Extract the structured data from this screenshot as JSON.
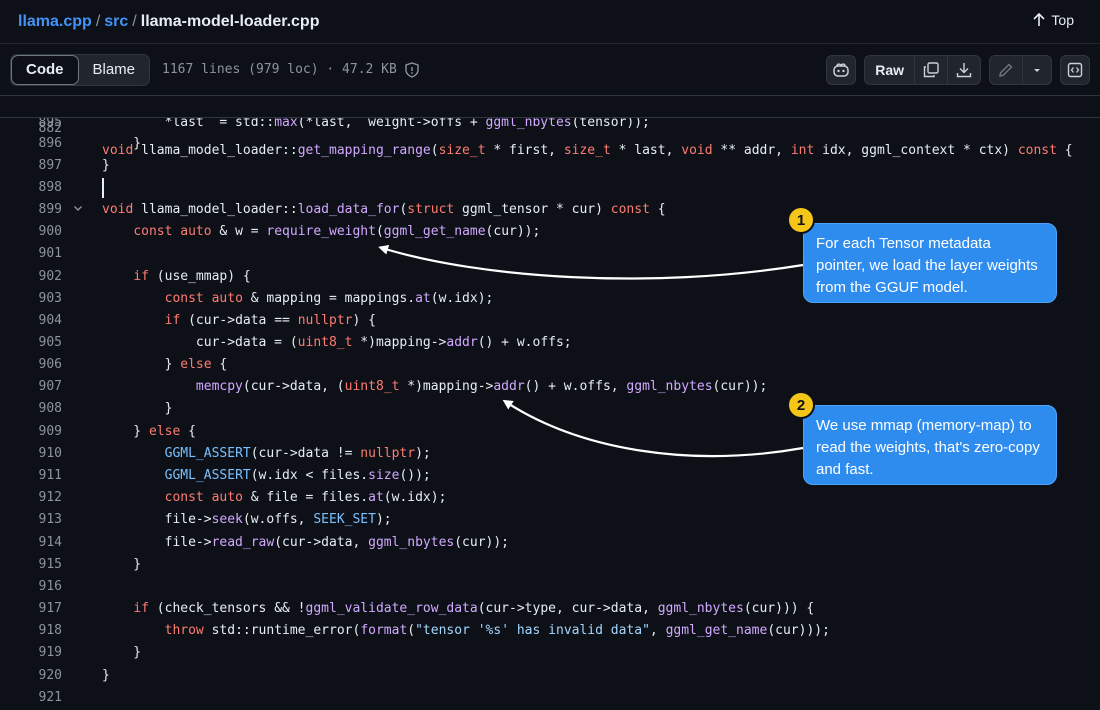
{
  "breadcrumb": {
    "repo": "llama.cpp",
    "sep": "/",
    "dir": "src",
    "file": "llama-model-loader.cpp"
  },
  "top_link": "Top",
  "toolbar": {
    "tab_code": "Code",
    "tab_blame": "Blame",
    "file_meta": "1167 lines (979 loc) · 47.2 KB",
    "raw_label": "Raw"
  },
  "callouts": [
    {
      "number": "1",
      "text": "For each Tensor metadata pointer, we load the layer weights from the GGUF model."
    },
    {
      "number": "2",
      "text": "We use mmap (memory-map) to read the weights, that's zero-copy and fast."
    }
  ],
  "code_lines": [
    {
      "n": "882",
      "code": "void llama_model_loader::get_mapping_range(size_t * first, size_t * last, void ** addr, int idx, ggml_context * ctx) const {"
    },
    {
      "n": "895",
      "code": "        *last  = std::max(*last,  weight->offs + ggml_nbytes(tensor));"
    },
    {
      "n": "896",
      "code": "    }"
    },
    {
      "n": "897",
      "code": "}"
    },
    {
      "n": "898",
      "code": ""
    },
    {
      "n": "899",
      "code": "void llama_model_loader::load_data_for(struct ggml_tensor * cur) const {"
    },
    {
      "n": "900",
      "code": "    const auto & w = require_weight(ggml_get_name(cur));"
    },
    {
      "n": "901",
      "code": ""
    },
    {
      "n": "902",
      "code": "    if (use_mmap) {"
    },
    {
      "n": "903",
      "code": "        const auto & mapping = mappings.at(w.idx);"
    },
    {
      "n": "904",
      "code": "        if (cur->data == nullptr) {"
    },
    {
      "n": "905",
      "code": "            cur->data = (uint8_t *)mapping->addr() + w.offs;"
    },
    {
      "n": "906",
      "code": "        } else {"
    },
    {
      "n": "907",
      "code": "            memcpy(cur->data, (uint8_t *)mapping->addr() + w.offs, ggml_nbytes(cur));"
    },
    {
      "n": "908",
      "code": "        }"
    },
    {
      "n": "909",
      "code": "    } else {"
    },
    {
      "n": "910",
      "code": "        GGML_ASSERT(cur->data != nullptr);"
    },
    {
      "n": "911",
      "code": "        GGML_ASSERT(w.idx < files.size());"
    },
    {
      "n": "912",
      "code": "        const auto & file = files.at(w.idx);"
    },
    {
      "n": "913",
      "code": "        file->seek(w.offs, SEEK_SET);"
    },
    {
      "n": "914",
      "code": "        file->read_raw(cur->data, ggml_nbytes(cur));"
    },
    {
      "n": "915",
      "code": "    }"
    },
    {
      "n": "916",
      "code": ""
    },
    {
      "n": "917",
      "code": "    if (check_tensors && !ggml_validate_row_data(cur->type, cur->data, ggml_nbytes(cur))) {"
    },
    {
      "n": "918",
      "code": "        throw std::runtime_error(format(\"tensor '%s' has invalid data\", ggml_get_name(cur)));"
    },
    {
      "n": "919",
      "code": "    }"
    },
    {
      "n": "920",
      "code": "}"
    },
    {
      "n": "921",
      "code": ""
    }
  ],
  "icons": {
    "top": "arrow-up-icon",
    "shield": "shield-icon",
    "copilot": "copilot-icon",
    "copy": "copy-icon",
    "download": "download-icon",
    "edit": "pencil-icon",
    "dropdown": "chevron-down-icon",
    "symbols": "code-square-icon",
    "fold": "chevron-down-icon"
  },
  "colors": {
    "accent": "#4493f8",
    "callout": "#2f8cef",
    "badge": "#f5c518",
    "keyword": "#ff7b72",
    "function": "#d2a8ff",
    "constant": "#79c0ff"
  }
}
